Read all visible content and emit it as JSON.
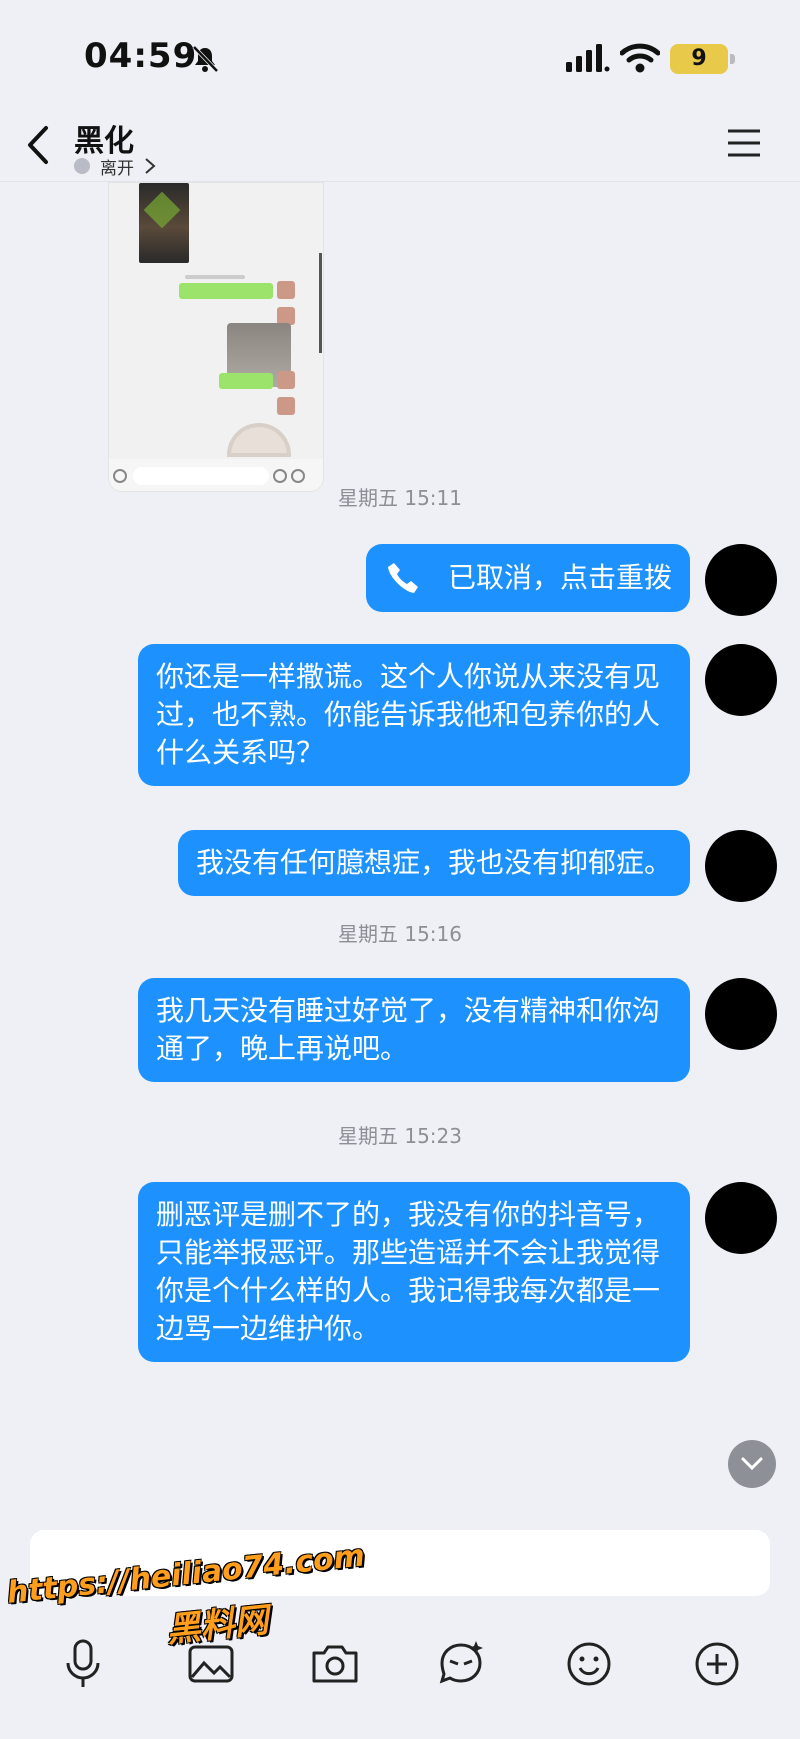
{
  "status_bar": {
    "time": "04:59",
    "battery": "9"
  },
  "header": {
    "contact_name": "黑化",
    "presence": "离开"
  },
  "messages": [
    {
      "timestamp": "星期五 15:11"
    },
    {
      "call_text": "已取消，点击重拨"
    },
    {
      "text": "你还是一样撒谎。这个人你说从来没有见过，也不熟。你能告诉我他和包养你的人什么关系吗？"
    },
    {
      "text": "我没有任何臆想症，我也没有抑郁症。"
    },
    {
      "timestamp": "星期五 15:16"
    },
    {
      "text": "我几天没有睡过好觉了，没有精神和你沟通了，晚上再说吧。"
    },
    {
      "timestamp": "星期五 15:23"
    },
    {
      "text": "删恶评是删不了的，我没有你的抖音号，只能举报恶评。那些造谣并不会让我觉得你是个什么样的人。我记得我每次都是一边骂一边维护你。"
    }
  ],
  "watermark": {
    "url": "https://heiliao74.com",
    "name": "黑料网"
  },
  "toolbar": [
    "microphone-icon",
    "image-icon",
    "camera-icon",
    "sticker-icon",
    "emoji-icon",
    "plus-icon"
  ],
  "colors": {
    "bubble": "#1d92ff",
    "background": "#eef0f5",
    "watermark": "#ff9d1c"
  }
}
